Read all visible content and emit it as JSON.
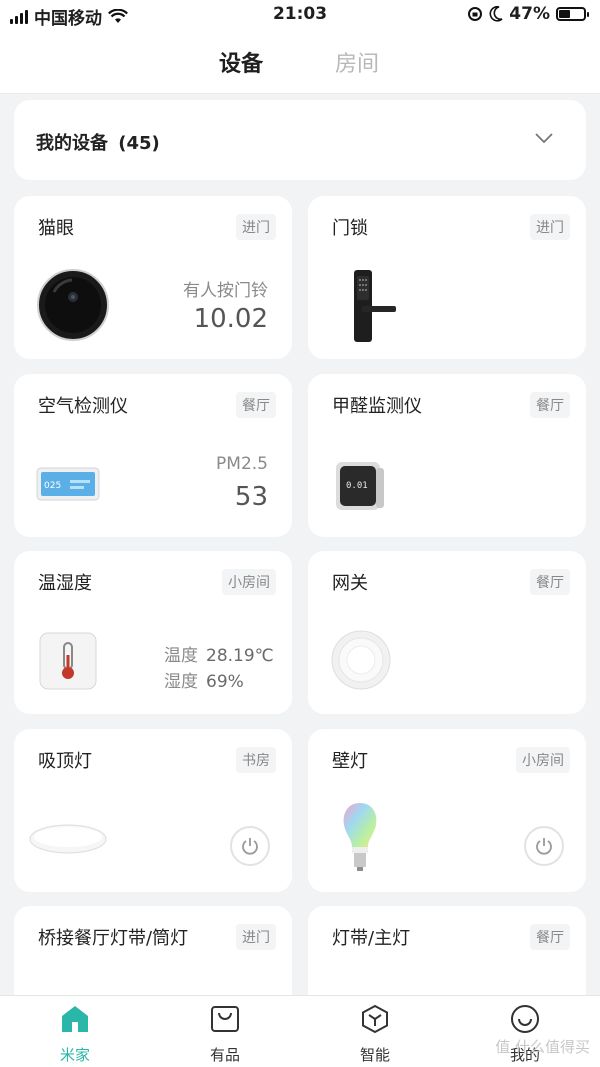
{
  "status_bar": {
    "carrier": "中国移动",
    "time": "21:03",
    "battery_percent": "47%",
    "battery_level": 0.47
  },
  "header": {
    "tabs": [
      {
        "label": "设备",
        "active": true
      },
      {
        "label": "房间",
        "active": false
      }
    ]
  },
  "my_devices": {
    "label": "我的设备",
    "count": "(45)"
  },
  "devices": [
    {
      "name": "猫眼",
      "room": "进门",
      "status_label": "有人按门铃",
      "status_value": "10.02",
      "icon": "peephole-camera-icon"
    },
    {
      "name": "门锁",
      "room": "进门",
      "icon": "door-lock-icon"
    },
    {
      "name": "空气检测仪",
      "room": "餐厅",
      "status_label": "PM2.5",
      "status_value": "53",
      "icon": "air-monitor-icon",
      "screen_text": "025"
    },
    {
      "name": "甲醛监测仪",
      "room": "餐厅",
      "icon": "formaldehyde-monitor-icon",
      "screen_text": "0.01"
    },
    {
      "name": "温湿度",
      "room": "小房间",
      "readings": [
        {
          "label": "温度",
          "value": "28.19℃"
        },
        {
          "label": "湿度",
          "value": "69%"
        }
      ],
      "icon": "thermometer-icon"
    },
    {
      "name": "网关",
      "room": "餐厅",
      "icon": "gateway-icon"
    },
    {
      "name": "吸顶灯",
      "room": "书房",
      "icon": "ceiling-light-icon"
    },
    {
      "name": "壁灯",
      "room": "小房间",
      "icon": "bulb-icon"
    },
    {
      "name": "桥接餐厅灯带/筒灯",
      "room": "进门"
    },
    {
      "name": "灯带/主灯",
      "room": "餐厅"
    }
  ],
  "tab_bar": [
    {
      "label": "米家",
      "icon": "home-icon",
      "active": true
    },
    {
      "label": "有品",
      "icon": "shopping-bag-icon",
      "active": false
    },
    {
      "label": "智能",
      "icon": "smart-hexagon-icon",
      "active": false
    },
    {
      "label": "我的",
      "icon": "smiley-icon",
      "active": false
    }
  ],
  "watermark": "值 什么值得买",
  "colors": {
    "accent": "#2ab7a9",
    "background": "#f2f3f5",
    "card": "#ffffff"
  }
}
